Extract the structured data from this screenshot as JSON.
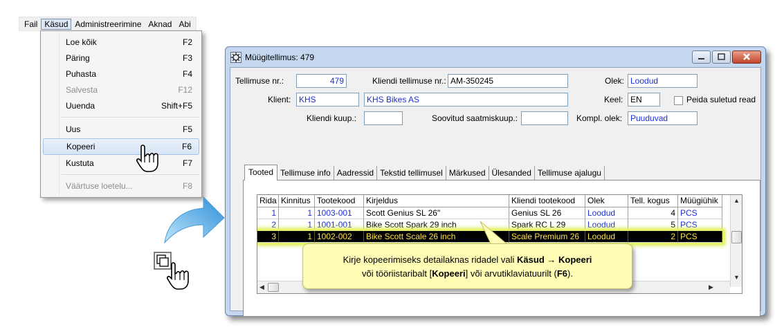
{
  "menubar": {
    "items": [
      "Fail",
      "Käsud",
      "Administreerimine",
      "Aknad",
      "Abi"
    ]
  },
  "dropdown": {
    "items": [
      {
        "label": "Loe kõik",
        "shortcut": "F2"
      },
      {
        "label": "Päring",
        "shortcut": "F3"
      },
      {
        "label": "Puhasta",
        "shortcut": "F4"
      },
      {
        "label": "Salvesta",
        "shortcut": "F12"
      },
      {
        "label": "Uuenda",
        "shortcut": "Shift+F5"
      },
      {
        "label": "Uus",
        "shortcut": "F5"
      },
      {
        "label": "Kopeeri",
        "shortcut": "F6"
      },
      {
        "label": "Kustuta",
        "shortcut": "F7"
      },
      {
        "label": "Väärtuse loetelu...",
        "shortcut": "F8"
      }
    ]
  },
  "window": {
    "title": "Müügitellimus: 479",
    "order_no_label": "Tellimuse nr.:",
    "order_no": "479",
    "client_order_label": "Kliendi tellimuse nr.:",
    "client_order": "AM-350245",
    "status_label": "Olek:",
    "status": "Loodud",
    "client_label": "Klient:",
    "client_code": "KHS",
    "client_name": "KHS Bikes AS",
    "lang_label": "Keel:",
    "lang": "EN",
    "hide_closed_label": "Peida suletud read",
    "client_date_label": "Kliendi kuup.:",
    "wished_date_label": "Soovitud saatmiskuup.:",
    "compl_label": "Kompl. olek:",
    "compl": "Puuduvad"
  },
  "tabs": [
    "Tooted",
    "Tellimuse info",
    "Aadressid",
    "Tekstid tellimusel",
    "Märkused",
    "Ülesanded",
    "Tellimuse ajalugu"
  ],
  "grid": {
    "headers": [
      "Rida",
      "Kinnitus",
      "Tootekood",
      "Kirjeldus",
      "Kliendi tootekood",
      "Olek",
      "Tell. kogus",
      "Müügiühik"
    ],
    "rows": [
      [
        "1",
        "1",
        "1003-001",
        "Scott Genius SL 26\"",
        "Genius SL 26",
        "Loodud",
        "4",
        "PCS"
      ],
      [
        "2",
        "1",
        "1001-001",
        "Bike Scott Spark 29 inch",
        "Spark RC L 29",
        "Loodud",
        "5",
        "PCS"
      ],
      [
        "3",
        "1",
        "1002-002",
        "Bike Scott Scale 26 inch",
        "Scale Premium 26",
        "Loodud",
        "2",
        "PCS"
      ]
    ]
  },
  "callout": {
    "line1_a": "Kirje kopeerimiseks detailaknas ridadel vali ",
    "line1_b": "Käsud",
    "line1_arrow": " → ",
    "line1_c": "Kopeeri",
    "line2_a": "või tööriistaribalt [",
    "line2_b": "Kopeeri",
    "line2_c": "] või arvutiklaviatuurilt (",
    "line2_d": "F6",
    "line2_e": ")."
  },
  "colors": {
    "accent_blue": "#1c2fd6",
    "highlight_row": "#000000",
    "highlight_text": "#ffe24a",
    "callout_bg": "#fffdb5"
  }
}
